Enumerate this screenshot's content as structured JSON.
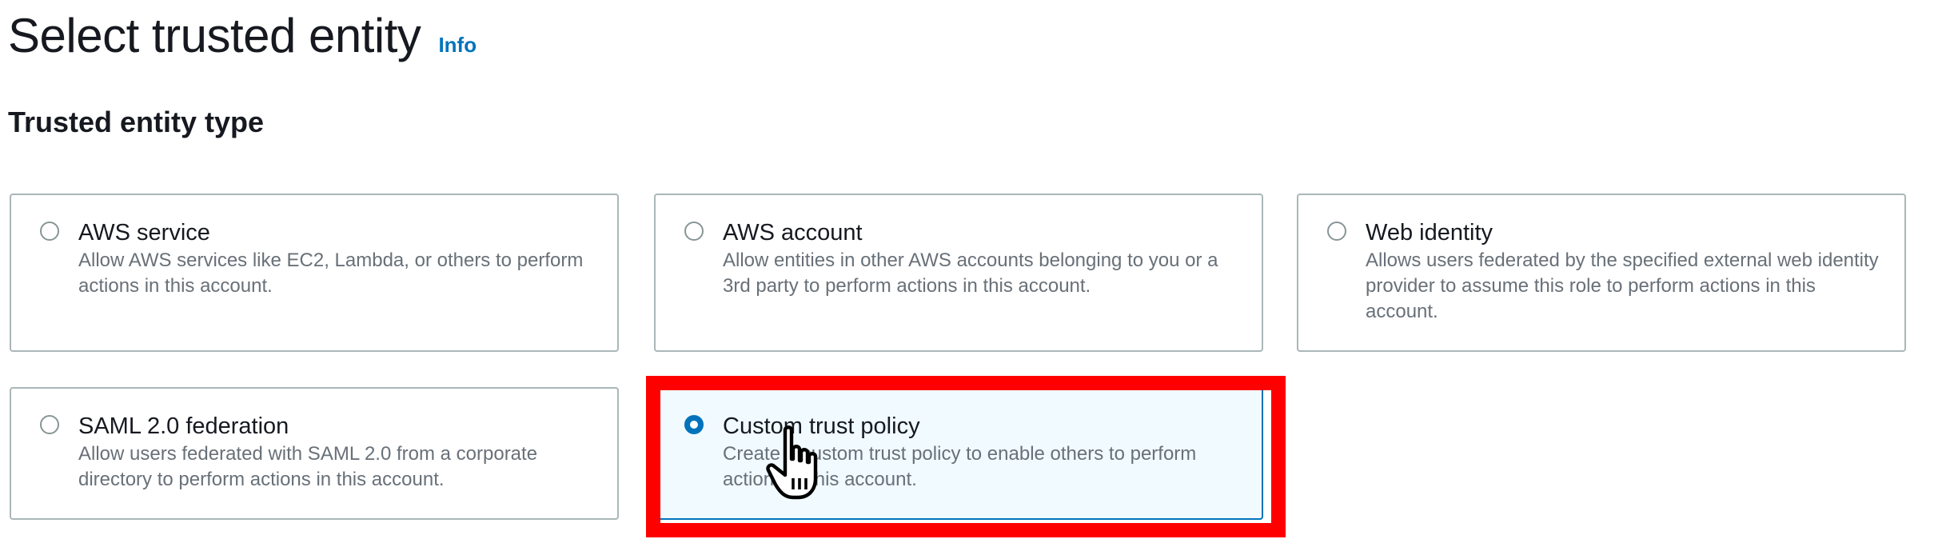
{
  "header": {
    "title": "Select trusted entity",
    "info_label": "Info"
  },
  "section": {
    "heading": "Trusted entity type"
  },
  "options": [
    {
      "title": "AWS service",
      "description": "Allow AWS services like EC2, Lambda, or others to perform actions in this account.",
      "selected": false
    },
    {
      "title": "AWS account",
      "description": "Allow entities in other AWS accounts belonging to you or a 3rd party to perform actions in this account.",
      "selected": false
    },
    {
      "title": "Web identity",
      "description": "Allows users federated by the specified external web identity provider to assume this role to perform actions in this account.",
      "selected": false
    },
    {
      "title": "SAML 2.0 federation",
      "description": "Allow users federated with SAML 2.0 from a corporate directory to perform actions in this account.",
      "selected": false
    },
    {
      "title": "Custom trust policy",
      "description": "Create a custom trust policy to enable others to perform actions in this account.",
      "selected": true
    }
  ],
  "colors": {
    "accent": "#0073bb",
    "highlight": "#ff0000",
    "selected_background": "#f1faff"
  }
}
